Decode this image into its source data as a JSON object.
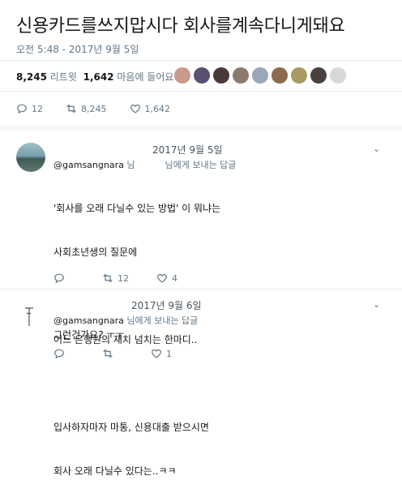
{
  "tweet": {
    "text": "신용카드를쓰지맙시다 회사를계속다니게돼요",
    "timestamp": "오전 5:48 - 2017년 9월 5일",
    "retweets_count": "8,245",
    "retweets_label": "리트윗",
    "likes_count": "1,642",
    "likes_label": "마음에 들어요",
    "avatar_colors": [
      "#c99a8c",
      "#5a5070",
      "#4b3a3a",
      "#8a7a6e",
      "#9aa7b6",
      "#8c6a4e",
      "#a89a62",
      "#4a4040",
      "#d8d8d8"
    ],
    "actions": {
      "reply": "12",
      "retweet": "8,245",
      "like": "1,642"
    }
  },
  "replies": [
    {
      "date": "2017년 9월 5일",
      "handle": "@gamsangnara",
      "suffix_a": "님",
      "suffix_b": "님에게 보내는 답글",
      "lines": [
        "'회사를 오래 다닐수 있는 방법' 이 뭐냐는",
        "사회초년생의 질문에",
        "",
        "어느 은행원의 재치 넘치는 한마디..",
        "",
        "입사하자마자 마통, 신용대출 받으시면",
        "회사 오래 다닐수 있다는..ㅋㅋ"
      ],
      "actions": {
        "reply": "",
        "retweet": "12",
        "like": "4"
      }
    },
    {
      "date": "2017년 9월 6일",
      "handle": "@gamsangnara",
      "suffix": "님에게 보내는 답글",
      "text": "그런건가요? ㅜㅜ",
      "actions": {
        "reply": "",
        "retweet": "",
        "like": "1"
      }
    }
  ],
  "colors": {
    "accent": "#1da1f2",
    "muted": "#657786",
    "text": "#14171a",
    "divider": "#e6ecf0"
  }
}
